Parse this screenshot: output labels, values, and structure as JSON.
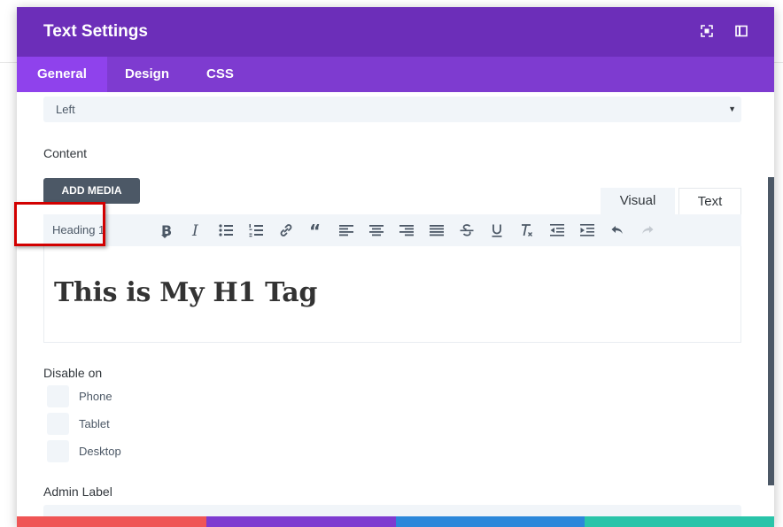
{
  "modal": {
    "title": "Text Settings",
    "header_icons": [
      "fullscreen-icon",
      "sidebar-icon"
    ]
  },
  "tabs": [
    {
      "label": "General",
      "active": true
    },
    {
      "label": "Design",
      "active": false
    },
    {
      "label": "CSS",
      "active": false
    }
  ],
  "alignment_select": {
    "value": "Left"
  },
  "content": {
    "label": "Content",
    "add_media_label": "ADD MEDIA",
    "mode_tabs": {
      "visual": "Visual",
      "text": "Text"
    },
    "format_select": "Heading 1",
    "toolbar_icons": [
      "bold-icon",
      "italic-icon",
      "bullet-list-icon",
      "numbered-list-icon",
      "link-icon",
      "blockquote-icon",
      "align-left-icon",
      "align-center-icon",
      "align-right-icon",
      "align-justify-icon",
      "strikethrough-icon",
      "underline-icon",
      "clear-format-icon",
      "outdent-icon",
      "indent-icon",
      "undo-icon",
      "redo-icon"
    ],
    "editor_text": "This is My H1 Tag"
  },
  "disable_on": {
    "label": "Disable on",
    "options": [
      "Phone",
      "Tablet",
      "Desktop"
    ]
  },
  "admin_label": {
    "label": "Admin Label"
  },
  "colors": {
    "header": "#6c2eb9",
    "tabs": "#7e3bd0",
    "active_tab": "#8f42ec",
    "highlight": "#d20000",
    "footer": [
      "#ef5555",
      "#7e3bd0",
      "#2b87da",
      "#29c4a9"
    ]
  }
}
